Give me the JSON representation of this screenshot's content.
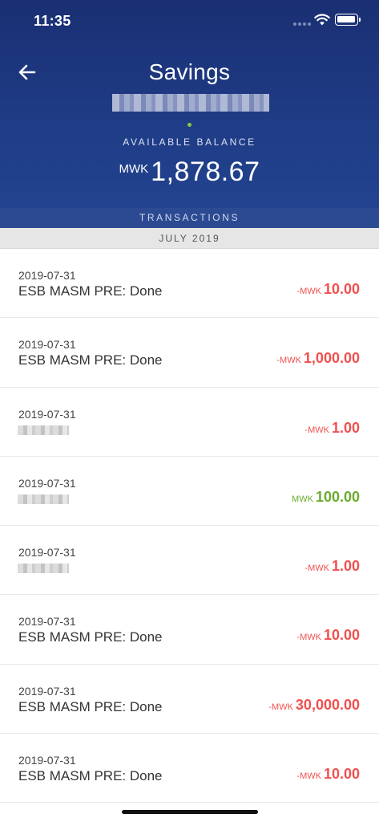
{
  "status_bar": {
    "time": "11:35"
  },
  "header": {
    "title": "Savings",
    "balance_label": "AVAILABLE BALANCE",
    "balance_currency": "MWK",
    "balance_amount": "1,878.67"
  },
  "transactions_label": "TRANSACTIONS",
  "month_label": "JULY 2019",
  "transactions": [
    {
      "date": "2019-07-31",
      "description": "ESB MASM PRE: Done",
      "sign": "-",
      "currency": "MWK",
      "amount": "10.00",
      "type": "debit"
    },
    {
      "date": "2019-07-31",
      "description": "ESB MASM PRE: Done",
      "sign": "-",
      "currency": "MWK",
      "amount": "1,000.00",
      "type": "debit"
    },
    {
      "date": "2019-07-31",
      "description": "",
      "sign": "-",
      "currency": "MWK",
      "amount": "1.00",
      "type": "debit"
    },
    {
      "date": "2019-07-31",
      "description": "",
      "sign": "",
      "currency": "MWK",
      "amount": "100.00",
      "type": "credit"
    },
    {
      "date": "2019-07-31",
      "description": "",
      "sign": "-",
      "currency": "MWK",
      "amount": "1.00",
      "type": "debit"
    },
    {
      "date": "2019-07-31",
      "description": "ESB MASM PRE: Done",
      "sign": "-",
      "currency": "MWK",
      "amount": "10.00",
      "type": "debit"
    },
    {
      "date": "2019-07-31",
      "description": "ESB MASM PRE: Done",
      "sign": "-",
      "currency": "MWK",
      "amount": "30,000.00",
      "type": "debit"
    },
    {
      "date": "2019-07-31",
      "description": "ESB MASM PRE: Done",
      "sign": "-",
      "currency": "MWK",
      "amount": "10.00",
      "type": "debit"
    }
  ],
  "colors": {
    "header_bg": "#1f3c86",
    "debit": "#f0504f",
    "credit": "#6bab2e",
    "accent_dot": "#8cc63f"
  },
  "icons": {
    "back": "arrow-left-icon",
    "wifi": "wifi-icon",
    "battery": "battery-icon",
    "signal": "signal-icon"
  }
}
